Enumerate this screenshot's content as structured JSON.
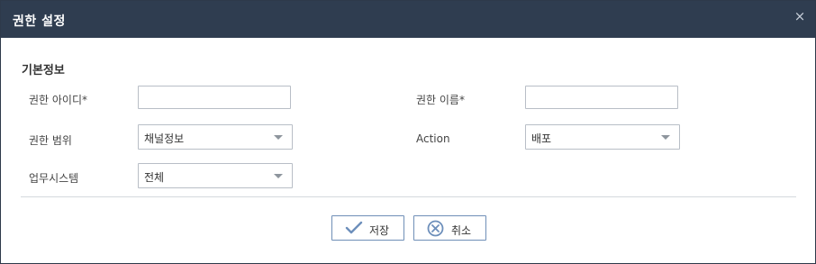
{
  "dialog": {
    "title": "권한 설정",
    "close_label": "×",
    "section_title": "기본정보"
  },
  "form": {
    "role_id": {
      "label": "권한 아이디*",
      "value": ""
    },
    "role_name": {
      "label": "권한 이름*",
      "value": ""
    },
    "role_scope": {
      "label": "권한 범위",
      "value": "채널정보"
    },
    "action": {
      "label": "Action",
      "value": "배포"
    },
    "business_system": {
      "label": "업무시스템",
      "value": "전체"
    }
  },
  "buttons": {
    "save_label": "저장",
    "cancel_label": "취소"
  },
  "colors": {
    "titlebar": "#2f3d50",
    "button_border": "#6f8fb7",
    "icon": "#6d8fbb"
  }
}
